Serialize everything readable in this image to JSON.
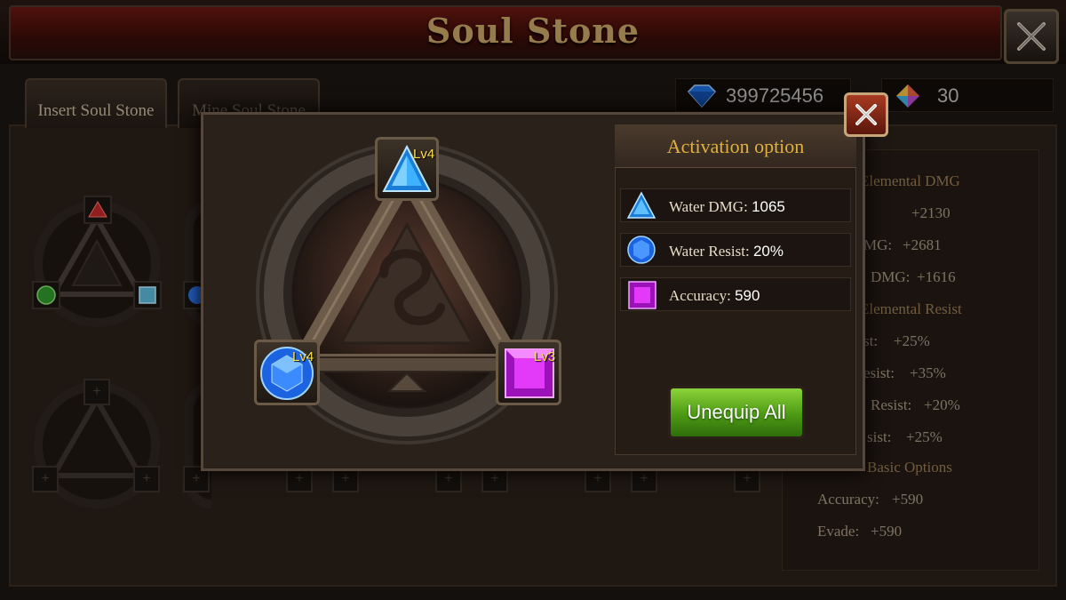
{
  "header": {
    "title": "Soul Stone"
  },
  "tabs": [
    {
      "label": "Insert Soul Stone",
      "active": true
    },
    {
      "label": "Mine Soul Stone",
      "active": false
    }
  ],
  "currency": [
    {
      "icon": "blue-diamond-icon",
      "value": "399725456"
    },
    {
      "icon": "rainbow-crystal-icon",
      "value": "30"
    }
  ],
  "stats_panel": {
    "rows": [
      {
        "kind": "head",
        "text": "Elemental DMG"
      },
      {
        "kind": "row",
        "label": ":",
        "value": "+2130"
      },
      {
        "kind": "row",
        "label": "MG:",
        "value": "+2681"
      },
      {
        "kind": "row",
        "label": "DMG:",
        "value": "+1616"
      },
      {
        "kind": "head",
        "text": "Elemental Resist"
      },
      {
        "kind": "row",
        "label": "st:",
        "value": "+25%"
      },
      {
        "kind": "row",
        "label": "esist:",
        "value": "+35%"
      },
      {
        "kind": "row",
        "label": "Resist:",
        "value": "+20%"
      },
      {
        "kind": "row",
        "label": "sist:",
        "value": "+25%"
      },
      {
        "kind": "head",
        "text": "Basic Options"
      },
      {
        "kind": "row",
        "label": "Accuracy:",
        "value": "+590"
      },
      {
        "kind": "row",
        "label": "Evade:",
        "value": "+590"
      }
    ]
  },
  "modal": {
    "stones": [
      {
        "position": "top",
        "shape": "triangle",
        "color": "#3aa8ff",
        "level": "Lv4"
      },
      {
        "position": "left",
        "shape": "round-gem",
        "color": "#2f7dff",
        "level": "Lv4"
      },
      {
        "position": "right",
        "shape": "square-gem",
        "color": "#d22ee8",
        "level": "Lv3"
      }
    ],
    "activation": {
      "title": "Activation option",
      "options": [
        {
          "icon": "blue-triangle-gem-icon",
          "label": "Water DMG:",
          "value": "1065"
        },
        {
          "icon": "blue-round-gem-icon",
          "label": "Water Resist:",
          "value": "20%"
        },
        {
          "icon": "purple-square-gem-icon",
          "label": "Accuracy:",
          "value": "590"
        }
      ]
    },
    "unequip_label": "Unequip All"
  }
}
